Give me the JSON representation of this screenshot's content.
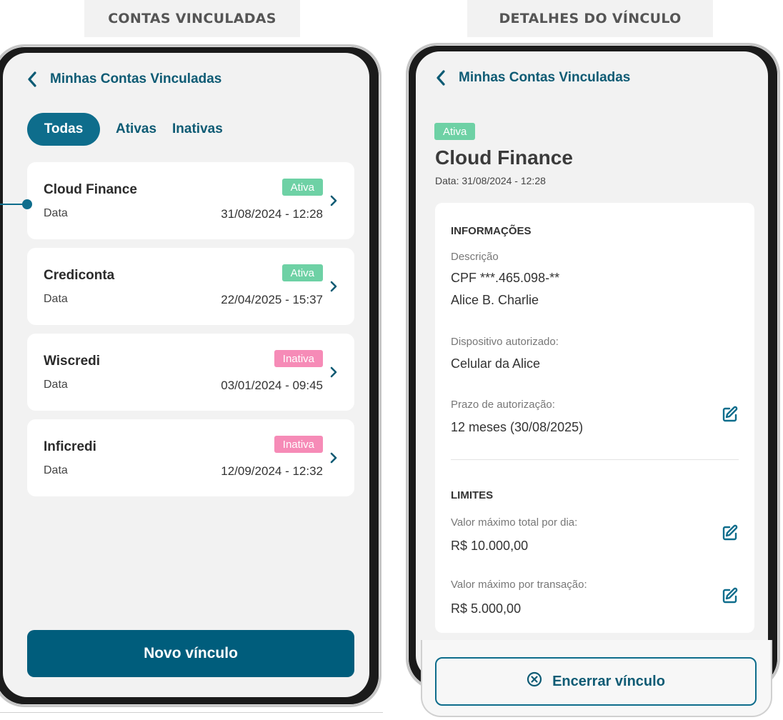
{
  "left_panel": {
    "title": "CONTAS VINCULADAS",
    "header_title": "Minhas Contas Vinculadas",
    "tabs": [
      {
        "label": "Todas",
        "active": true
      },
      {
        "label": "Ativas",
        "active": false
      },
      {
        "label": "Inativas",
        "active": false
      }
    ],
    "date_label": "Data",
    "accounts": [
      {
        "name": "Cloud Finance",
        "status": "Ativa",
        "date": "31/08/2024 - 12:28"
      },
      {
        "name": "Crediconta",
        "status": "Ativa",
        "date": "22/04/2025 - 15:37"
      },
      {
        "name": "Wiscredi",
        "status": "Inativa",
        "date": "03/01/2024 - 09:45"
      },
      {
        "name": "Inficredi",
        "status": "Inativa",
        "date": "12/09/2024 - 12:32"
      }
    ],
    "primary_button": "Novo vínculo"
  },
  "right_panel": {
    "title": "DETALHES DO  VÍNCULO",
    "header_title": "Minhas Contas Vinculadas",
    "status": "Ativa",
    "name": "Cloud Finance",
    "date": "Data: 31/08/2024 - 12:28",
    "info_heading": "INFORMAÇÕES",
    "description_label": "Descrição",
    "cpf": "CPF ***.465.098-**",
    "holder": "Alice B. Charlie",
    "device_label": "Dispositivo autorizado:",
    "device": "Celular da Alice",
    "term_label": "Prazo de autorização:",
    "term": "12 meses (30/08/2025)",
    "limits_heading": "LIMITES",
    "daily_label": "Valor máximo total por dia:",
    "daily_value": "R$ 10.000,00",
    "per_tx_label": "Valor máximo por transação:",
    "per_tx_value": "R$ 5.000,00",
    "end_button": "Encerrar vínculo"
  },
  "colors": {
    "primary": "#005d7c",
    "accent": "#0e6d8c",
    "active_badge": "#6ed1a5",
    "inactive_badge": "#f68bb7"
  },
  "icons": [
    "chevron-left-icon",
    "chevron-right-icon",
    "edit-icon",
    "close-circle-icon"
  ]
}
